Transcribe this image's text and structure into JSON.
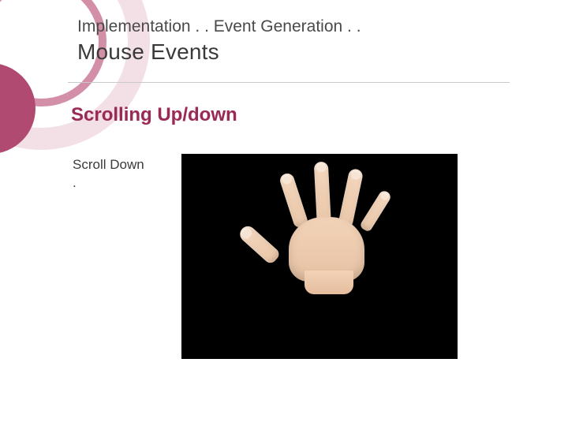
{
  "header": {
    "breadcrumb": "Implementation . . Event Generation . .",
    "title": "Mouse Events"
  },
  "section_heading": "Scrolling Up/down",
  "caption_lines": {
    "line1": "Scroll Down",
    "line2": "."
  },
  "media": {
    "description": "hand-open-gesture"
  }
}
